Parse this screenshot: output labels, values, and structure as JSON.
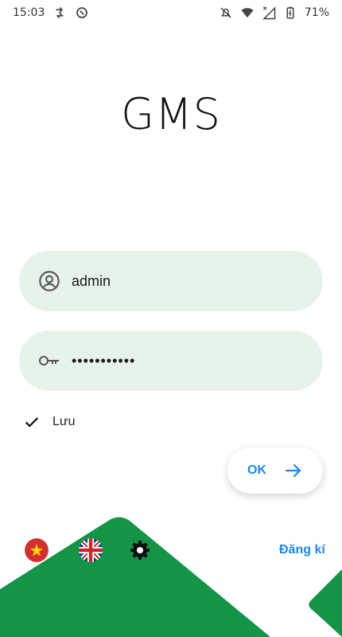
{
  "status_bar": {
    "time": "15:03",
    "battery": "71%",
    "icons": [
      "data-saver-icon",
      "sync-icon",
      "do-not-disturb-icon",
      "wifi-icon",
      "signal-icon",
      "battery-icon"
    ]
  },
  "app": {
    "title": "GMS"
  },
  "login": {
    "username_value": "admin",
    "password_value": "•••••••••••",
    "remember_label": "Lưu",
    "submit_label": "OK"
  },
  "footer": {
    "register_label": "Đăng kí",
    "languages": [
      "vietnamese-flag-icon",
      "uk-flag-icon"
    ]
  },
  "colors": {
    "field_bg": "#e5f3e9",
    "accent_blue": "#1e88e5",
    "green": "#139447"
  }
}
